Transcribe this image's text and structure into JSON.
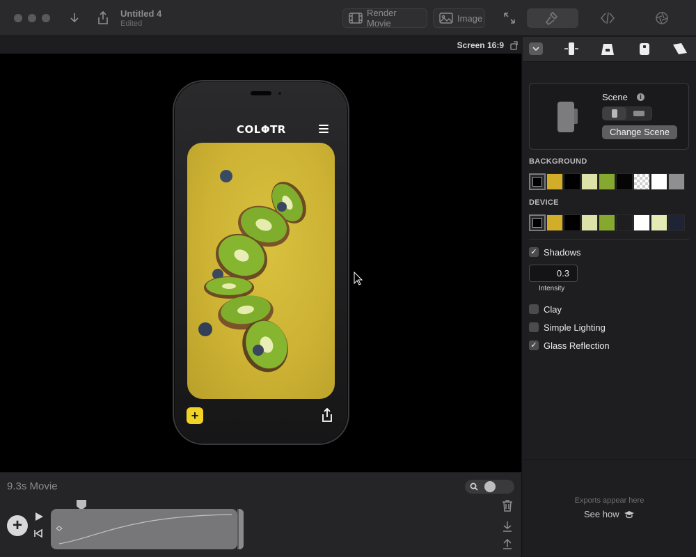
{
  "window": {
    "title": "Untitled 4",
    "subtitle": "Edited"
  },
  "toolbar": {
    "render_movie_label": "Render Movie",
    "image_label": "Image"
  },
  "canvas": {
    "screen_label": "Screen 16:9"
  },
  "phone": {
    "logo_text": "COLΦTR"
  },
  "timeline": {
    "movie_label": "9.3s Movie"
  },
  "panel": {
    "scene_title": "Scene",
    "change_scene_label": "Change Scene",
    "background_label": "BACKGROUND",
    "device_label": "DEVICE",
    "background_swatches": [
      "#000000",
      "#d1ad2a",
      "#000000",
      "#dde3a8",
      "#86a82e",
      "#050505",
      "checker",
      "#ffffff",
      "#8f8f8f"
    ],
    "device_swatches": [
      "#000000",
      "#d1ad2a",
      "#000000",
      "#dde3a8",
      "#86a82e",
      "#1e1e20",
      "#ffffff",
      "#e5ebb4",
      "#1e2335"
    ],
    "shadows_label": "Shadows",
    "intensity_value": "0.3",
    "intensity_label": "Intensity",
    "clay_label": "Clay",
    "simple_lighting_label": "Simple Lighting",
    "glass_reflection_label": "Glass Reflection",
    "shadows_checked": true,
    "clay_checked": false,
    "simple_lighting_checked": false,
    "glass_reflection_checked": true,
    "exports_text": "Exports appear here",
    "see_how_label": "See how"
  },
  "colors": {
    "accent_yellow": "#f1d326",
    "hero_background": "#cdb233"
  }
}
